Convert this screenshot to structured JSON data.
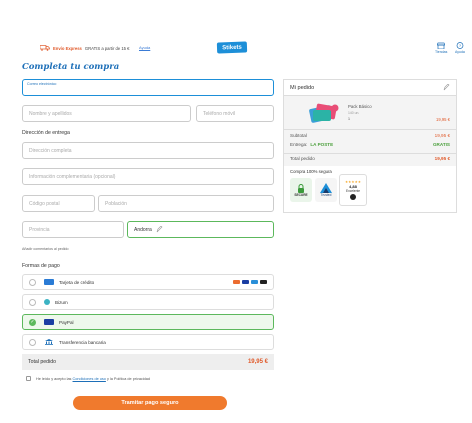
{
  "topbar": {
    "shipping_bold": "Envío Express",
    "shipping_text": "GRATIS a partir de 15 €",
    "help_link": "Ayuda",
    "logo": "Stikets",
    "icon_tiendas": "Tiendas",
    "icon_ayuda": "Ayuda"
  },
  "page": {
    "title": "Completa tu compra"
  },
  "form": {
    "email_label": "Correo electrónico",
    "name_placeholder": "Nombre y apellidos",
    "phone_placeholder": "Teléfono móvil",
    "address_heading": "Dirección de entrega",
    "address_placeholder": "Dirección completa",
    "extra_placeholder": "Información complementaria (opcional)",
    "zip_placeholder": "Código postal",
    "city_placeholder": "Población",
    "province_placeholder": "Provincia",
    "country_value": "Andorra",
    "comment_link": "Añadir comentarios al pedido"
  },
  "payment": {
    "heading": "Formas de pago",
    "methods": [
      {
        "label": "Tarjeta de crédito",
        "icon": "credit-card-icon"
      },
      {
        "label": "Bizum",
        "icon": "bizum-icon"
      },
      {
        "label": "PayPal",
        "icon": "paypal-icon"
      },
      {
        "label": "Transferencia bancaria",
        "icon": "bank-icon"
      }
    ],
    "selected": "PayPal"
  },
  "total": {
    "label": "Total pedido",
    "value": "19,95 €"
  },
  "terms": {
    "prefix": "He leído y acepto las",
    "link": "Condiciones de uso",
    "suffix": "y la Política de privacidad"
  },
  "submit": {
    "label": "Tramitar pago seguro"
  },
  "order": {
    "title": "Mi pedido",
    "product_name": "Pack Básico",
    "product_sub": "140 un.",
    "product_qty": "1",
    "product_price": "19,95 €",
    "subtotal_label": "Subtotal",
    "subtotal_value": "19,95 €",
    "shipping_label": "Entrega:",
    "shipping_method": "LA POSTE",
    "shipping_value": "GRATIS",
    "total_label": "Total pedido",
    "total_value": "19,95 €",
    "secure_label": "Compra 100% segura",
    "badges": {
      "secure": "SECURE",
      "trusted": "Trusted",
      "rating": "4,88",
      "rating_label": "Excelente"
    }
  },
  "colors": {
    "accent": "#1d8fd8",
    "orange": "#f07a2d",
    "green": "#5cb85c"
  }
}
